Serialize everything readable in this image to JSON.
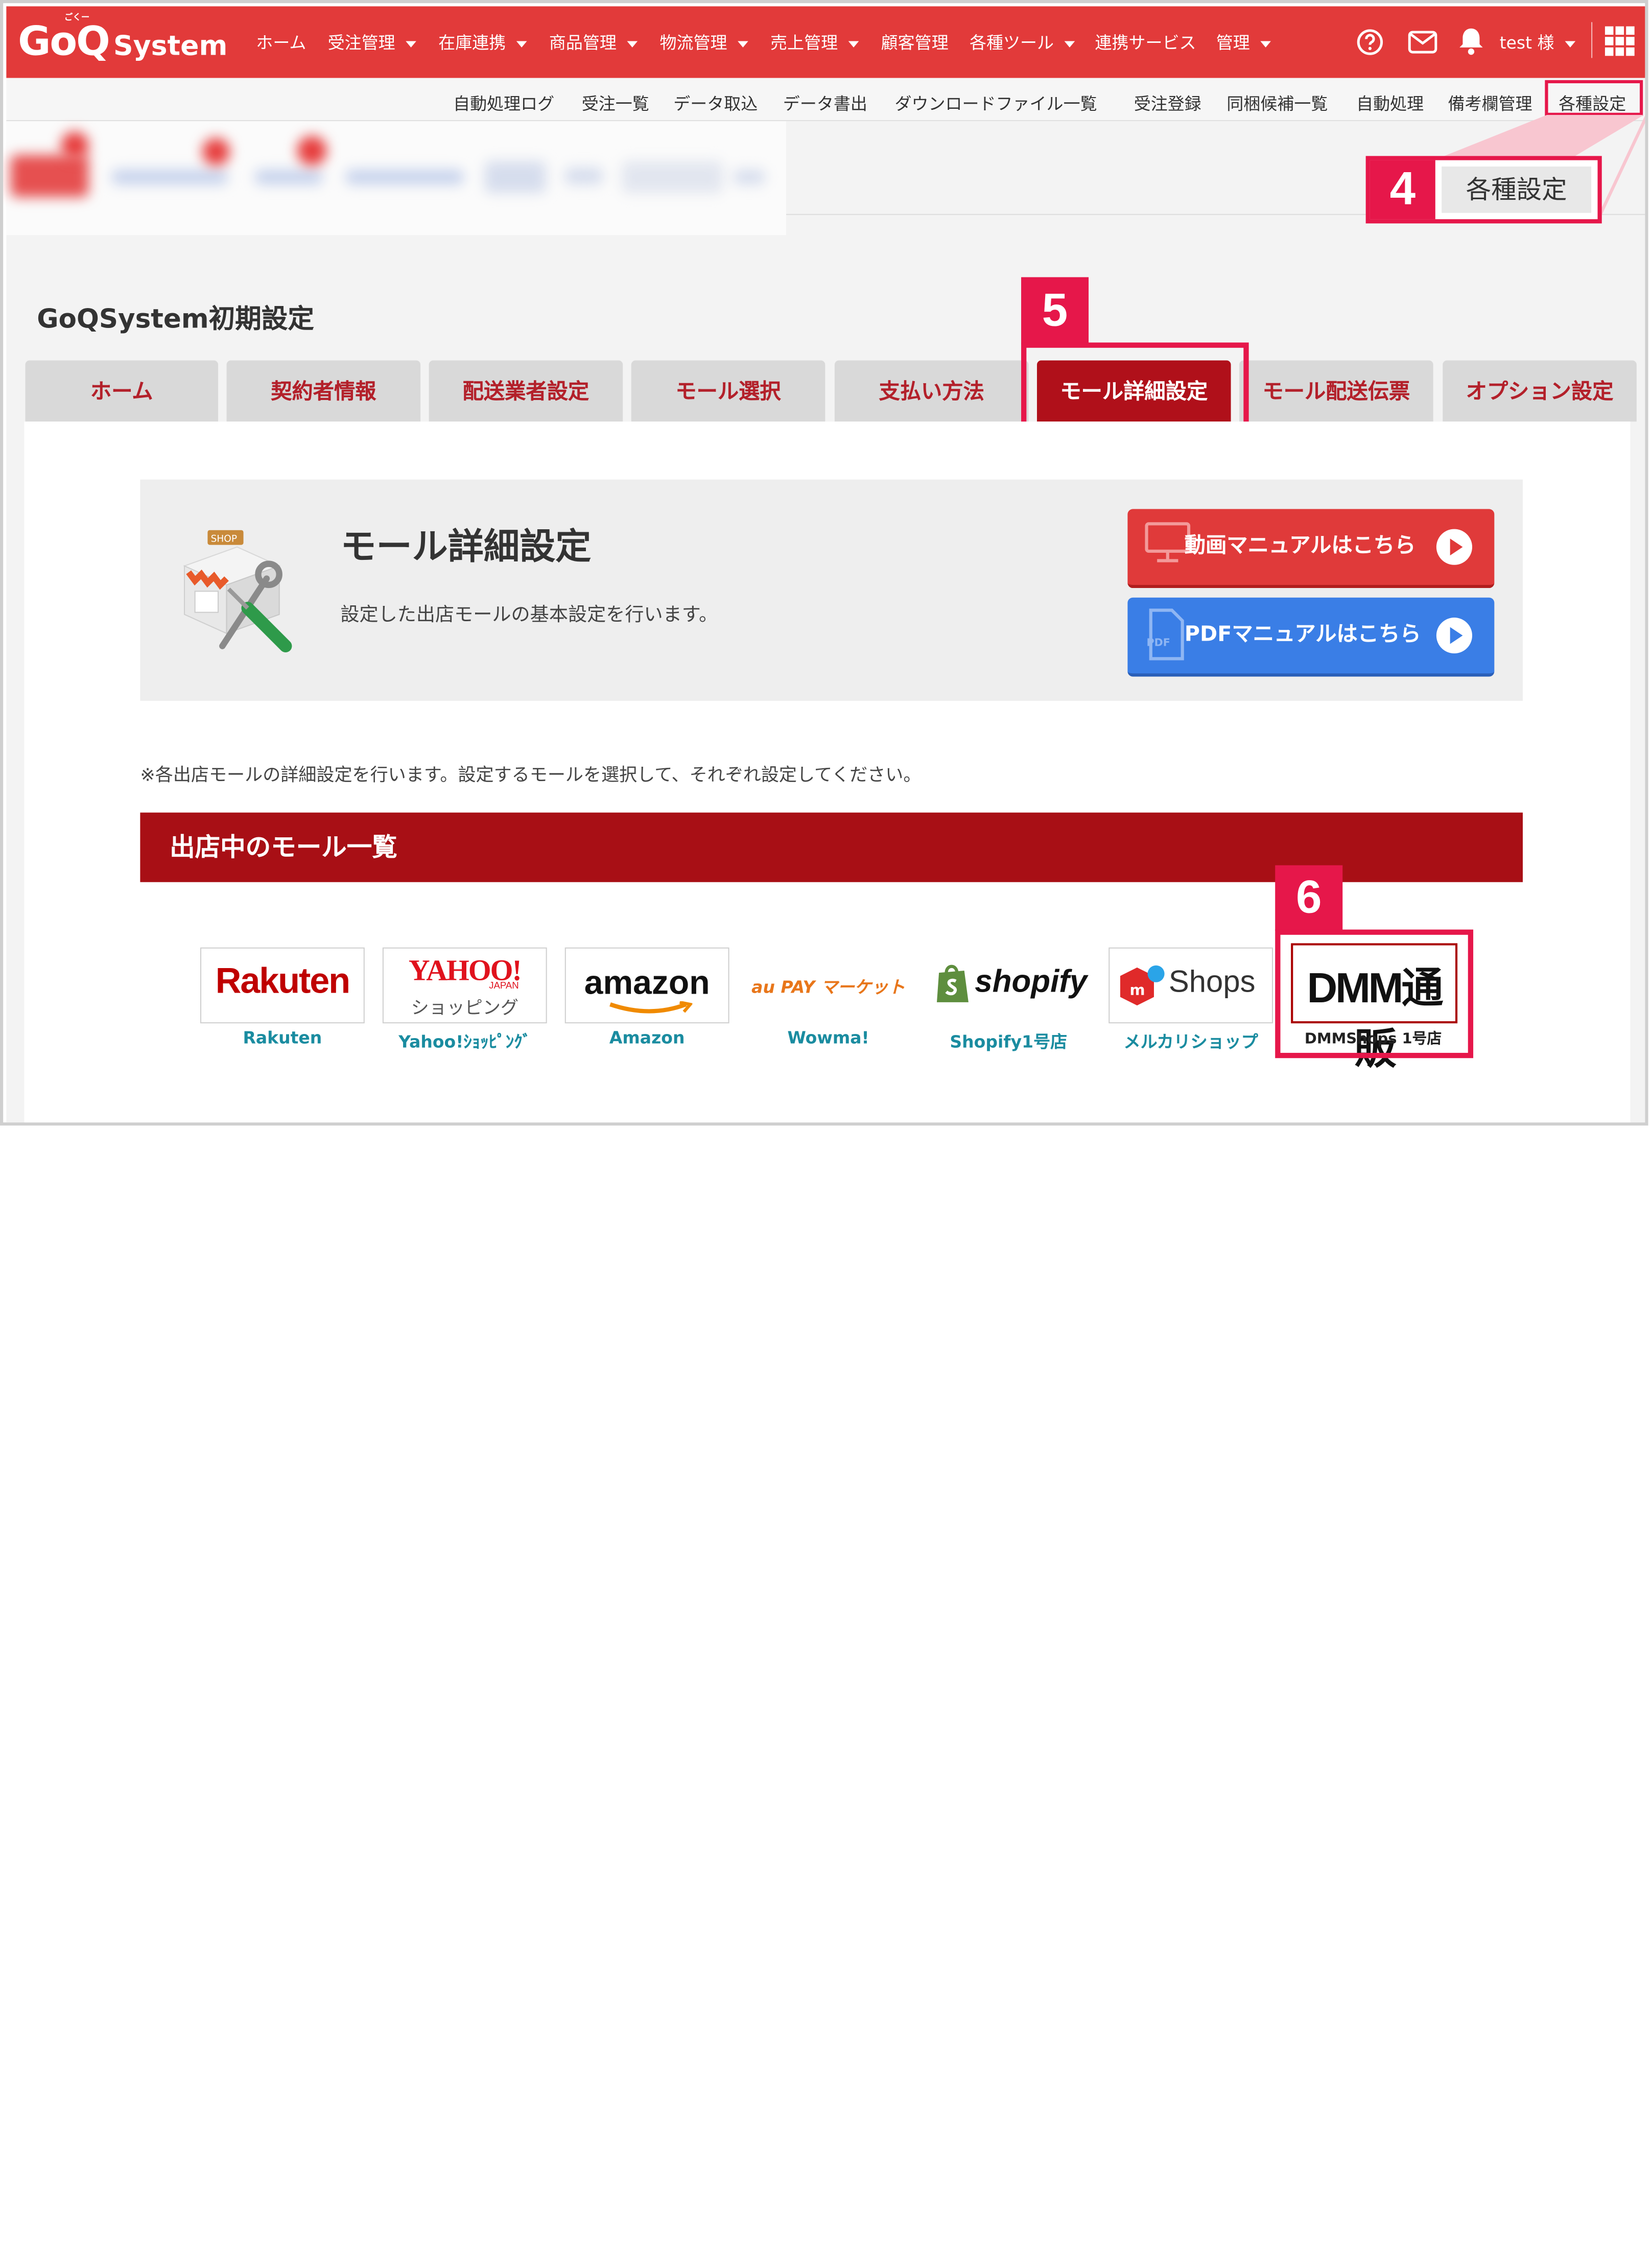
{
  "brand": {
    "logo_main": "GoQ",
    "logo_sub": "System",
    "logo_kana": "ごくー"
  },
  "topnav": {
    "items": [
      {
        "label": "ホーム",
        "dropdown": false
      },
      {
        "label": "受注管理",
        "dropdown": true
      },
      {
        "label": "在庫連携",
        "dropdown": true
      },
      {
        "label": "商品管理",
        "dropdown": true
      },
      {
        "label": "物流管理",
        "dropdown": true
      },
      {
        "label": "売上管理",
        "dropdown": true
      },
      {
        "label": "顧客管理",
        "dropdown": false
      },
      {
        "label": "各種ツール",
        "dropdown": true
      },
      {
        "label": "連携サービス",
        "dropdown": false
      },
      {
        "label": "管理",
        "dropdown": true
      }
    ],
    "user_label": "test 様",
    "help_icon": "question-circle-icon",
    "mail_icon": "envelope-icon",
    "bell_icon": "bell-icon",
    "apps_icon": "grid-icon"
  },
  "subnav": {
    "items": [
      "自動処理ログ",
      "受注一覧",
      "データ取込",
      "データ書出",
      "ダウンロードファイル一覧",
      "受注登録",
      "同梱候補一覧",
      "自動処理",
      "備考欄管理",
      "各種設定"
    ]
  },
  "callouts": {
    "step4_number": "4",
    "step4_label": "各種設定",
    "step5_number": "5",
    "step6_number": "6"
  },
  "page": {
    "title": "GoQSystem初期設定",
    "tabs": [
      {
        "label": "ホーム",
        "active": false
      },
      {
        "label": "契約者情報",
        "active": false
      },
      {
        "label": "配送業者設定",
        "active": false
      },
      {
        "label": "モール選択",
        "active": false
      },
      {
        "label": "支払い方法",
        "active": false
      },
      {
        "label": "モール詳細設定",
        "active": true
      },
      {
        "label": "モール配送伝票",
        "active": false
      },
      {
        "label": "オプション設定",
        "active": false
      }
    ]
  },
  "hero": {
    "title": "モール詳細設定",
    "description": "設定した出店モールの基本設定を行います。",
    "video_button": "動画マニュアルはこちら",
    "pdf_button": "PDFマニュアルはこちら",
    "pdf_icon_text": "PDF",
    "shop_sign": "SHOP"
  },
  "note": "※各出店モールの詳細設定を行います。設定するモールを選択して、それぞれ設定してください。",
  "mall_section": {
    "heading": "出店中のモール一覧",
    "malls": [
      {
        "logo_text": "Rakuten",
        "label": "Rakuten"
      },
      {
        "logo_text": "YAHOO!",
        "logo_sub": "ショッピング",
        "logo_small": "JAPAN",
        "label": "Yahoo!ｼｮｯﾋﾟﾝｸﾞ"
      },
      {
        "logo_text": "amazon",
        "label": "Amazon"
      },
      {
        "logo_text": "au PAY マーケット",
        "label": "Wowma!"
      },
      {
        "logo_text": "shopify",
        "label": "Shopify1号店"
      },
      {
        "logo_text": "Shops",
        "label": "メルカリショップ"
      },
      {
        "logo_text": "DMM通販",
        "label": "DMMShops 1号店"
      }
    ]
  },
  "colors": {
    "header_red": "#e23a3a",
    "active_tab": "#b0101a",
    "callout": "#e6174a",
    "video_button": "#e03a3a",
    "pdf_button": "#3a7ee6",
    "mall_label": "#1a8ca0",
    "banner": "#a80f15"
  }
}
